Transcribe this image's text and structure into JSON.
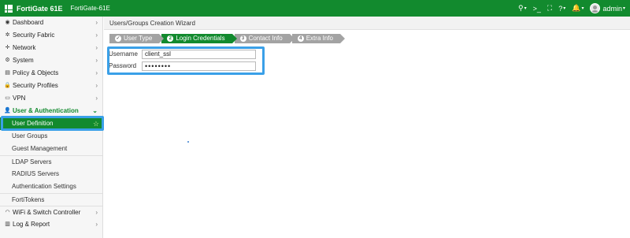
{
  "topbar": {
    "product": "FortiGate 61E",
    "hostname": "FortiGate-61E",
    "user": "admin",
    "icons": [
      "search-icon",
      "cli-console-icon",
      "fullscreen-icon",
      "help-icon",
      "notification-bell-icon",
      "user-avatar"
    ]
  },
  "sidebar": {
    "items": [
      {
        "label": "Dashboard",
        "icon": "dashboard-icon"
      },
      {
        "label": "Security Fabric",
        "icon": "fabric-icon"
      },
      {
        "label": "Network",
        "icon": "network-icon"
      },
      {
        "label": "System",
        "icon": "gear-icon"
      },
      {
        "label": "Policy & Objects",
        "icon": "policy-icon"
      },
      {
        "label": "Security Profiles",
        "icon": "lock-icon"
      },
      {
        "label": "VPN",
        "icon": "vpn-icon"
      },
      {
        "label": "User & Authentication",
        "icon": "user-icon"
      }
    ],
    "sub_items": [
      "User Definition",
      "User Groups",
      "Guest Management",
      "LDAP Servers",
      "RADIUS Servers",
      "Authentication Settings",
      "FortiTokens"
    ],
    "bottom_items": [
      {
        "label": "WiFi & Switch Controller",
        "icon": "wifi-icon"
      },
      {
        "label": "Log & Report",
        "icon": "report-icon"
      }
    ]
  },
  "wizard": {
    "title": "Users/Groups Creation Wizard",
    "steps": [
      {
        "num": "✓",
        "label": "User Type"
      },
      {
        "num": "2",
        "label": "Login Credentials"
      },
      {
        "num": "3",
        "label": "Contact Info"
      },
      {
        "num": "4",
        "label": "Extra Info"
      }
    ],
    "username_label": "Username",
    "username_value": "client_ssl",
    "password_label": "Password",
    "password_value": "••••••••"
  },
  "colors": {
    "brand": "#128a2e",
    "highlight": "#3aa0e8"
  }
}
